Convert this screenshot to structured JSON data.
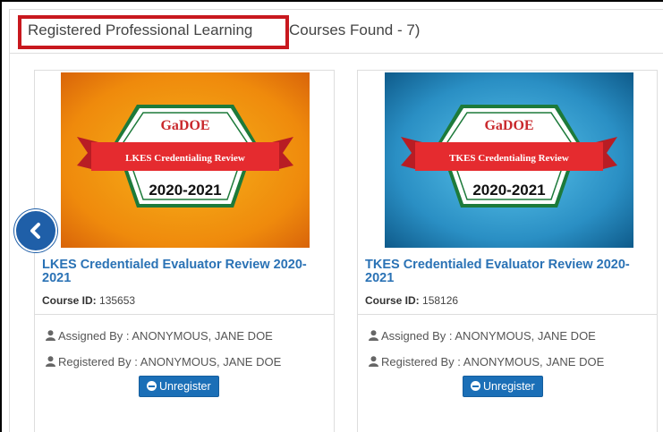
{
  "header": {
    "title": "Registered Professional Learning",
    "count_text": "Courses Found - 7)"
  },
  "nav": {
    "prev_icon": "chevron-left-icon"
  },
  "colors": {
    "highlight_border": "#c8181e",
    "link": "#2a72b5",
    "button": "#1b6fb7"
  },
  "courses": [
    {
      "badge_logo": "GaDOE",
      "badge_ribbon": "LKES Credentialing Review",
      "badge_year": "2020-2021",
      "title": "LKES Credentialed Evaluator Review 2020-2021",
      "id_label": "Course ID:",
      "id_value": "135653",
      "assigned_by": "Assigned By : ANONYMOUS, JANE DOE",
      "registered_by": "Registered By : ANONYMOUS, JANE DOE",
      "button_label": "Unregister",
      "bg": "orange"
    },
    {
      "badge_logo": "GaDOE",
      "badge_ribbon": "TKES Credentialing Review",
      "badge_year": "2020-2021",
      "title": "TKES Credentialed Evaluator Review 2020-2021",
      "id_label": "Course ID:",
      "id_value": "158126",
      "assigned_by": "Assigned By : ANONYMOUS, JANE DOE",
      "registered_by": "Registered By : ANONYMOUS, JANE DOE",
      "button_label": "Unregister",
      "bg": "blue"
    }
  ]
}
